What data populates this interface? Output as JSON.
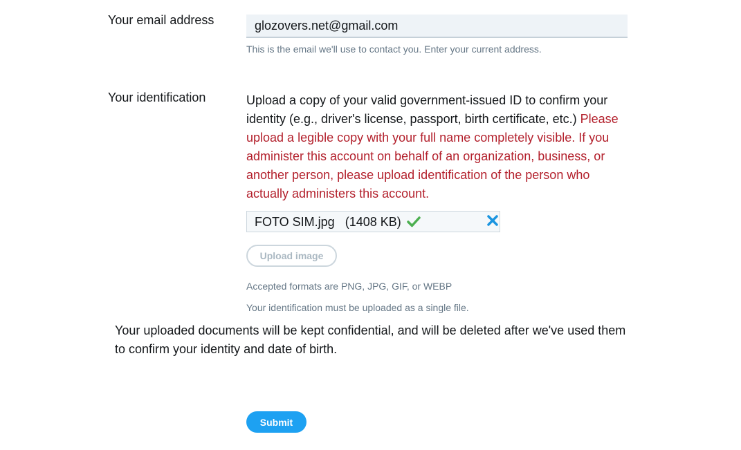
{
  "email": {
    "label": "Your email address",
    "value": "glozovers.net@gmail.com",
    "help": "This is the email we'll use to contact you. Enter your current address."
  },
  "identification": {
    "label": "Your identification",
    "instructions": "Upload a copy of your valid government-issued ID to confirm your identity (e.g., driver's license, passport, birth certificate, etc.)",
    "warning": "Please upload a legible copy with your full name completely visible. If you administer this account on behalf of an organization, business, or another person, please upload identification of the person who actually administers this account.",
    "file": {
      "name": "FOTO SIM.jpg",
      "size": "(1408 KB)",
      "status_icon": "check-icon",
      "remove_icon": "close-icon"
    },
    "upload_button": "Upload image",
    "formats_note": "Accepted formats are PNG, JPG, GIF, or WEBP",
    "single_file_note": "Your identification must be uploaded as a single file."
  },
  "confidential_note": "Your uploaded documents will be kept confidential, and will be deleted after we've used them to confirm your identity and date of birth.",
  "submit_button": "Submit",
  "colors": {
    "accent": "#1da1f2",
    "warning": "#b3202c",
    "success": "#4caf50",
    "muted": "#657786"
  }
}
